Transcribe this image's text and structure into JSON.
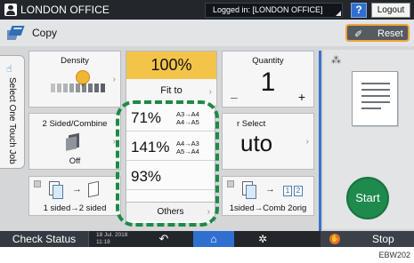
{
  "top_bar": {
    "office_title": "LONDON OFFICE",
    "login_status": "Logged in: [LONDON OFFICE]",
    "help_label": "?",
    "logout_label": "Logout"
  },
  "app_header": {
    "title": "Copy",
    "reset_label": "Reset"
  },
  "side_tab": {
    "label": "Select One Touch Job"
  },
  "tiles": {
    "density": {
      "label": "Density"
    },
    "reduce_enlarge": {
      "value": "100%",
      "option": "Fit to"
    },
    "quantity": {
      "label": "Quantity",
      "value": "1",
      "minus": "–",
      "plus": "+"
    },
    "sided_combine": {
      "label": "2 Sided/Combine",
      "state": "Off"
    },
    "paper_select": {
      "label": "r Select",
      "value": "uto"
    },
    "one_sided_to_two_sided": {
      "label": "1 sided→2 sided"
    },
    "one_sided_to_comb": {
      "label": "1sided→Comb 2orig",
      "page_1": "1",
      "page_2": "2"
    }
  },
  "ratio_presets": [
    {
      "value": "71%",
      "line1": "A3→A4",
      "line2": "A4→A5"
    },
    {
      "value": "141%",
      "line1": "A4→A3",
      "line2": "A5→A4"
    },
    {
      "value": "93%",
      "line1": "",
      "line2": ""
    }
  ],
  "others_label": "Others",
  "start_label": "Start",
  "bottom_bar": {
    "check_status": "Check Status",
    "date": "18 Jul. 2018",
    "time": "11:18",
    "stop_label": "Stop"
  },
  "figure_code": "EBW202",
  "colors": {
    "accent_blue": "#2f6fd0",
    "selected_yellow": "#f3c44a",
    "start_green": "#1f8a4d",
    "highlight_green": "#1e8a45",
    "reset_border": "#f2a33a"
  }
}
